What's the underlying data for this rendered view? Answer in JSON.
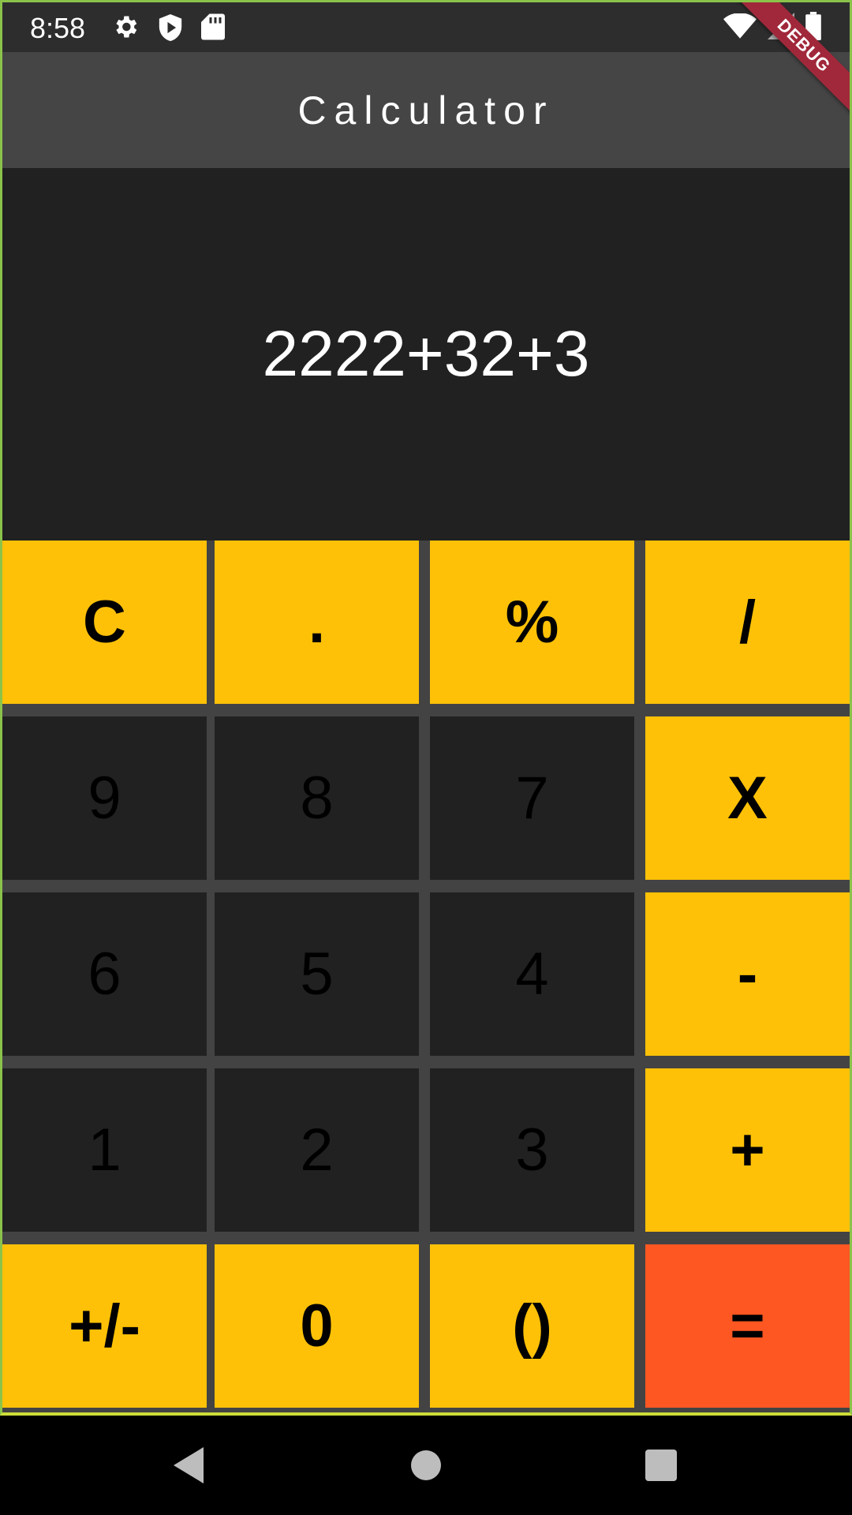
{
  "status_bar": {
    "time": "8:58",
    "left_icons": [
      "gear-icon",
      "shield-play-icon",
      "sd-card-icon"
    ],
    "right_icons": [
      "wifi-icon",
      "signal-icon",
      "battery-icon"
    ]
  },
  "debug_banner": "DEBUG",
  "app_bar": {
    "title": "Calculator"
  },
  "display": {
    "expression": "2222+32+3"
  },
  "colors": {
    "accent": "#ffc107",
    "equals": "#ff5722",
    "key_dark": "#212121",
    "display_bg": "#212121",
    "app_bar_bg": "#454545"
  },
  "keys": [
    [
      "C",
      ".",
      "%",
      "/"
    ],
    [
      "9",
      "8",
      "7",
      "X"
    ],
    [
      "6",
      "5",
      "4",
      "-"
    ],
    [
      "1",
      "2",
      "3",
      "+"
    ],
    [
      "+/-",
      "0",
      "()",
      "="
    ]
  ],
  "nav": [
    "back-icon",
    "home-icon",
    "recents-icon"
  ]
}
